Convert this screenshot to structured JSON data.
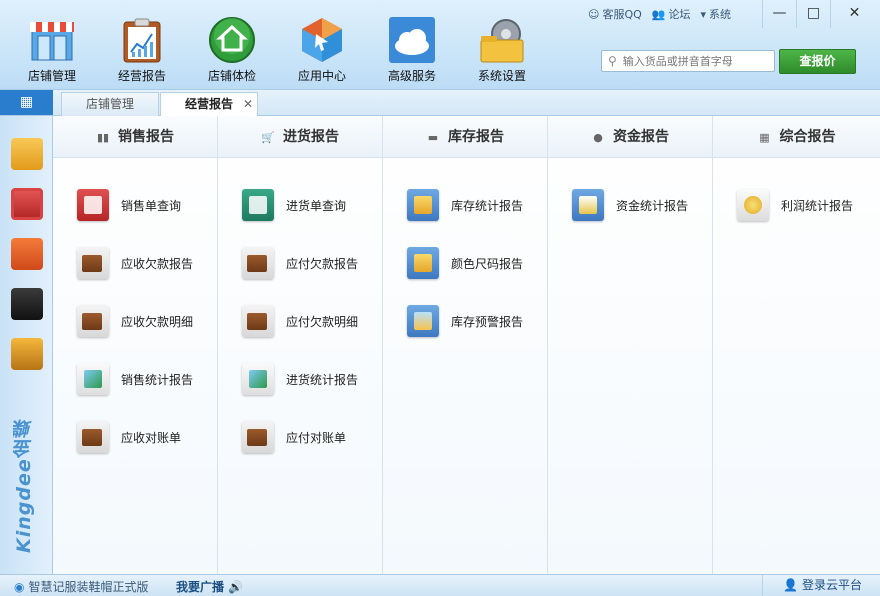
{
  "toolbar": {
    "items": [
      {
        "label": "店铺管理",
        "icon": "store-icon"
      },
      {
        "label": "经营报告",
        "icon": "report-clipboard-icon"
      },
      {
        "label": "店铺体检",
        "icon": "home-check-icon"
      },
      {
        "label": "应用中心",
        "icon": "app-center-icon"
      },
      {
        "label": "高级服务",
        "icon": "cloud-icon"
      },
      {
        "label": "系统设置",
        "icon": "gear-folder-icon"
      }
    ],
    "links": {
      "service": "客服QQ",
      "forum": "论坛",
      "system": "系统"
    },
    "window": {
      "minimize": "—",
      "maximize": "□",
      "close": "✕"
    },
    "search": {
      "placeholder": "输入货品或拼音首字母"
    },
    "quote_button": "查报价"
  },
  "tabs": {
    "grid_icon": "grid-menu-icon",
    "tab1": "店铺管理",
    "tab2": "经营报告",
    "close": "✕"
  },
  "sidebar": {
    "brand": "Kingdee金蝶",
    "icons": [
      "boxes-icon",
      "clipboard-icon",
      "vip-card-icon",
      "phone-icon",
      "notebook-icon"
    ]
  },
  "columns": [
    {
      "title": "销售报告",
      "icon": "bar-chart-icon",
      "items": [
        {
          "label": "销售单查询",
          "icon": "sales-order-icon"
        },
        {
          "label": "应收欠款报告",
          "icon": "wallet-icon"
        },
        {
          "label": "应收欠款明细",
          "icon": "wallet-detail-icon"
        },
        {
          "label": "销售统计报告",
          "icon": "line-chart-icon"
        },
        {
          "label": "应收对账单",
          "icon": "statement-icon"
        }
      ]
    },
    {
      "title": "进货报告",
      "icon": "cart-icon",
      "items": [
        {
          "label": "进货单查询",
          "icon": "purchase-order-icon"
        },
        {
          "label": "应付欠款报告",
          "icon": "wallet-icon"
        },
        {
          "label": "应付欠款明细",
          "icon": "wallet-detail-icon"
        },
        {
          "label": "进货统计报告",
          "icon": "line-chart-icon"
        },
        {
          "label": "应付对账单",
          "icon": "statement-icon"
        }
      ]
    },
    {
      "title": "库存报告",
      "icon": "box-icon",
      "items": [
        {
          "label": "库存统计报告",
          "icon": "stock-icon"
        },
        {
          "label": "颜色尺码报告",
          "icon": "color-size-icon"
        },
        {
          "label": "库存预警报告",
          "icon": "warning-icon"
        }
      ]
    },
    {
      "title": "资金报告",
      "icon": "coin-icon",
      "items": [
        {
          "label": "资金统计报告",
          "icon": "fund-icon"
        }
      ]
    },
    {
      "title": "综合报告",
      "icon": "grid-icon",
      "items": [
        {
          "label": "利润统计报告",
          "icon": "money-bag-icon"
        }
      ]
    }
  ],
  "status": {
    "version": "智慧记服装鞋帽正式版",
    "broadcast": "我要广播",
    "login": "登录云平台"
  },
  "colors": {
    "accent": "#2a7ccd",
    "quote": "#2e8b2a"
  }
}
